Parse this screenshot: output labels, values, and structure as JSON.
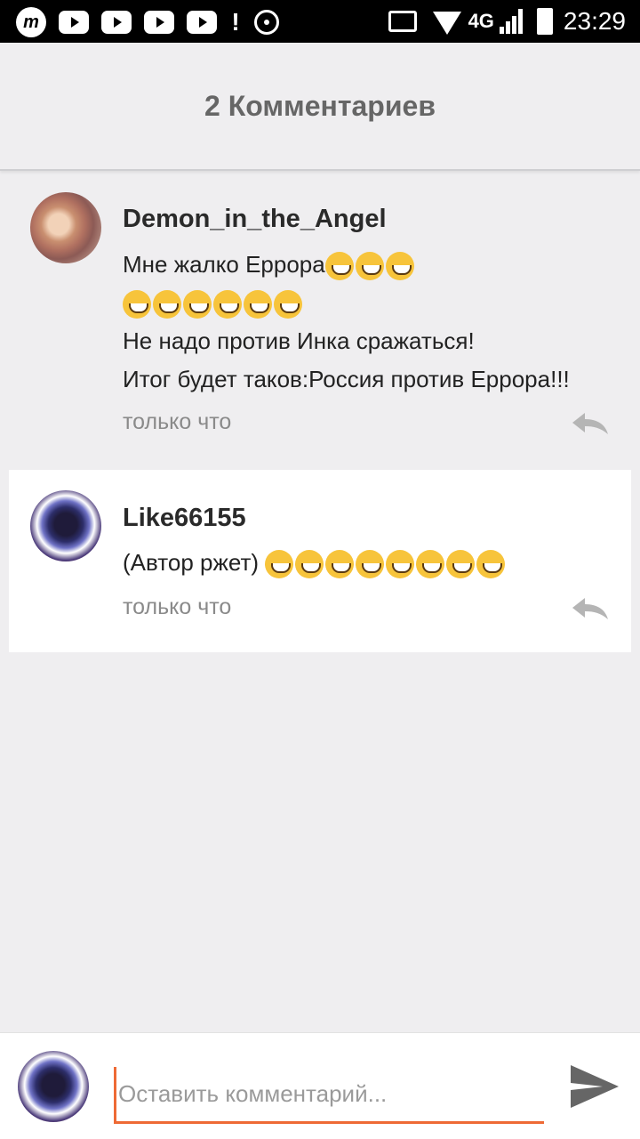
{
  "status_bar": {
    "network": "4G",
    "time": "23:29",
    "app_icon_letter": "m"
  },
  "header": {
    "title": "2 Комментариев"
  },
  "comments": [
    {
      "author": "Demon_in_the_Angel",
      "lines": [
        "Мне жалко Еррора",
        "",
        "Не надо против Инка сражаться!",
        "Итог будет таков:Россия против Еррора!!!"
      ],
      "time": "только что",
      "avatar_icon": "user-photo-avatar"
    },
    {
      "author": "Like66155",
      "lines": [
        "(Автор ржет) "
      ],
      "time": "только что",
      "avatar_icon": "anime-avatar"
    }
  ],
  "input": {
    "placeholder": "Оставить комментарий..."
  },
  "colors": {
    "accent": "#ee6a35",
    "background": "#efeef0",
    "highlight_card": "#ffffff"
  }
}
